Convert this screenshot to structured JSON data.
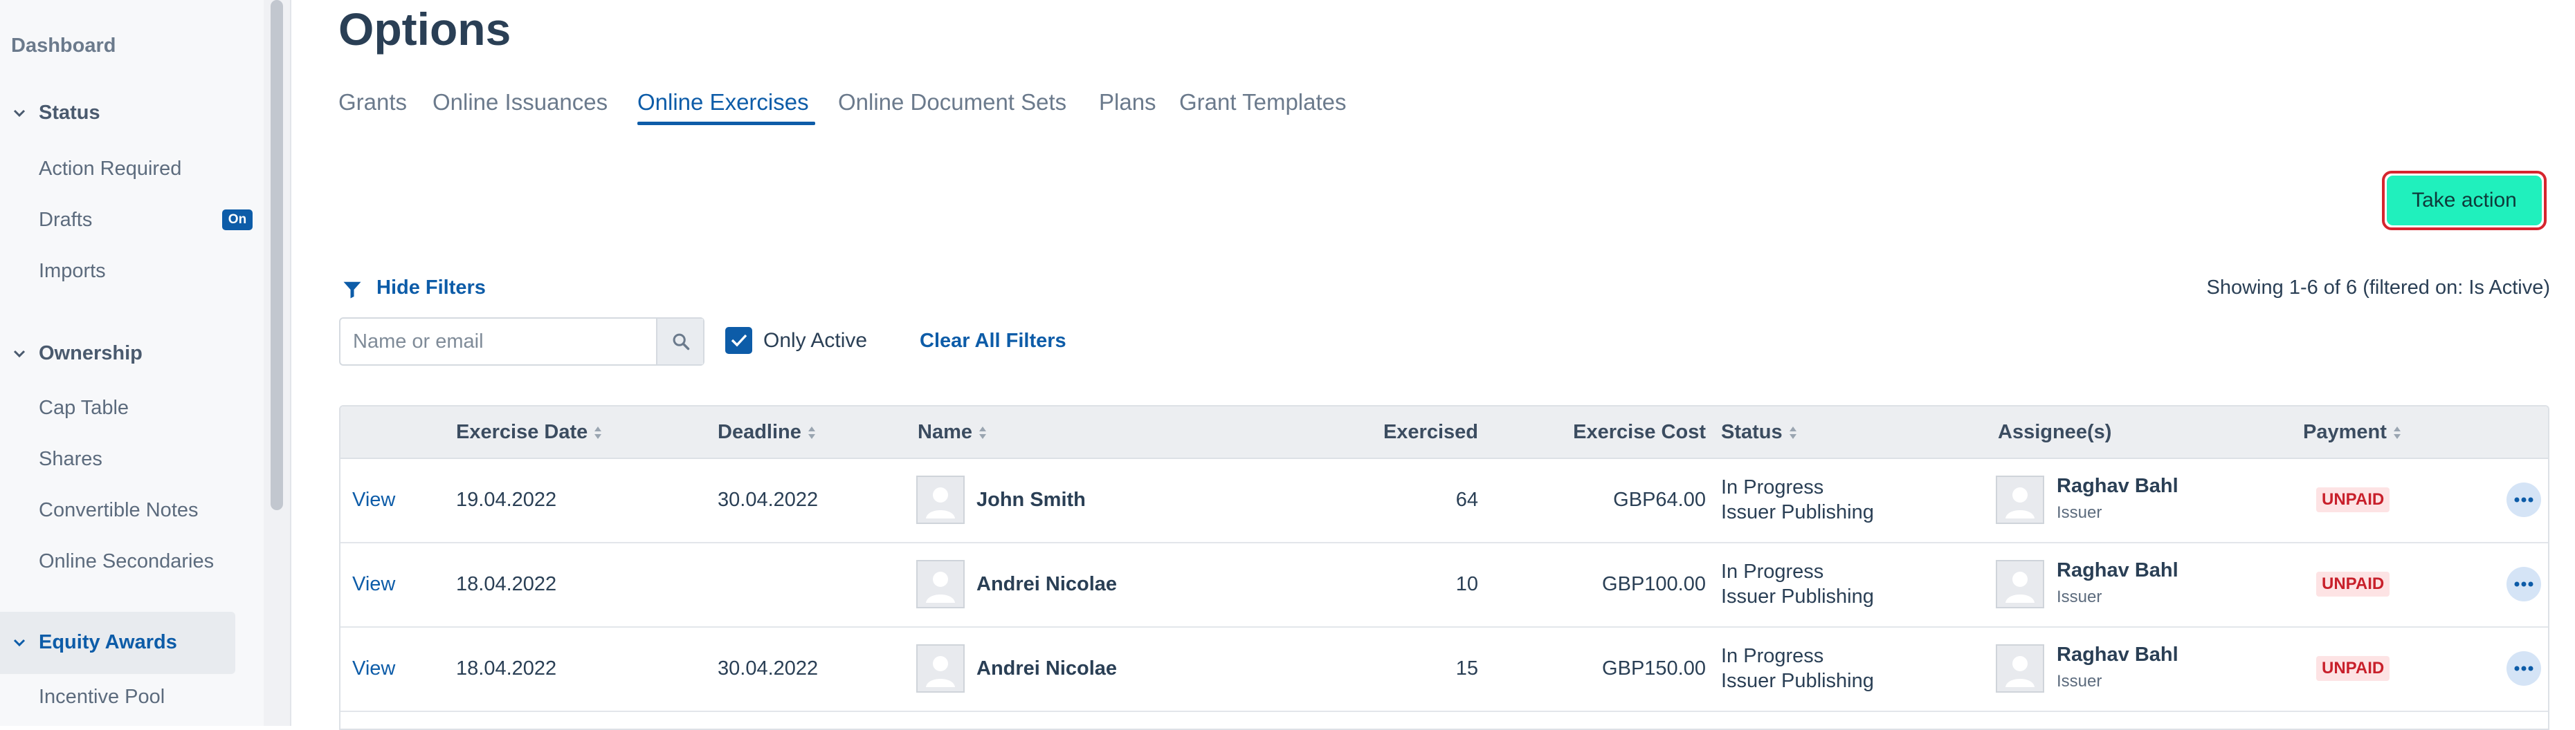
{
  "sidebar": {
    "dashboard": "Dashboard",
    "sections": [
      {
        "label": "Status",
        "items": [
          "Action Required",
          "Drafts",
          "Imports"
        ]
      },
      {
        "label": "Ownership",
        "items": [
          "Cap Table",
          "Shares",
          "Convertible Notes",
          "Online Secondaries"
        ]
      },
      {
        "label": "Equity Awards",
        "items": [
          "Incentive Pool"
        ]
      }
    ],
    "drafts_badge": "On"
  },
  "page": {
    "title": "Options"
  },
  "tabs": [
    {
      "label": "Grants",
      "active": false
    },
    {
      "label": "Online Issuances",
      "active": false
    },
    {
      "label": "Online Exercises",
      "active": true
    },
    {
      "label": "Online Document Sets",
      "active": false
    },
    {
      "label": "Plans",
      "active": false
    },
    {
      "label": "Grant Templates",
      "active": false
    }
  ],
  "actions": {
    "take_action": "Take action"
  },
  "filters": {
    "hide_filters": "Hide Filters",
    "search_placeholder": "Name or email",
    "search_value": "",
    "only_active_label": "Only Active",
    "only_active_checked": true,
    "clear_all": "Clear All Filters",
    "showing": "Showing 1-6 of 6 (filtered on: Is Active)"
  },
  "table": {
    "columns": [
      "Exercise Date",
      "Deadline",
      "Name",
      "Exercised",
      "Exercise Cost",
      "Status",
      "Assignee(s)",
      "Payment"
    ],
    "view_label": "View",
    "rows": [
      {
        "view": "View",
        "exercise_date": "19.04.2022",
        "deadline": "30.04.2022",
        "name": "John Smith",
        "exercised": "64",
        "exercise_cost": "GBP64.00",
        "status_line1": "In Progress",
        "status_line2": "Issuer Publishing",
        "assignee": "Raghav Bahl",
        "assignee_role": "Issuer",
        "payment": "UNPAID"
      },
      {
        "view": "View",
        "exercise_date": "18.04.2022",
        "deadline": "",
        "name": "Andrei Nicolae",
        "exercised": "10",
        "exercise_cost": "GBP100.00",
        "status_line1": "In Progress",
        "status_line2": "Issuer Publishing",
        "assignee": "Raghav Bahl",
        "assignee_role": "Issuer",
        "payment": "UNPAID"
      },
      {
        "view": "View",
        "exercise_date": "18.04.2022",
        "deadline": "30.04.2022",
        "name": "Andrei Nicolae",
        "exercised": "15",
        "exercise_cost": "GBP150.00",
        "status_line1": "In Progress",
        "status_line2": "Issuer Publishing",
        "assignee": "Raghav Bahl",
        "assignee_role": "Issuer",
        "payment": "UNPAID"
      }
    ]
  },
  "colors": {
    "accent": "#0d5ca8",
    "cta": "#20f0bd",
    "cta_outline": "#d6262f",
    "unpaid_bg": "#fde3e4",
    "unpaid_text": "#c8202b"
  }
}
